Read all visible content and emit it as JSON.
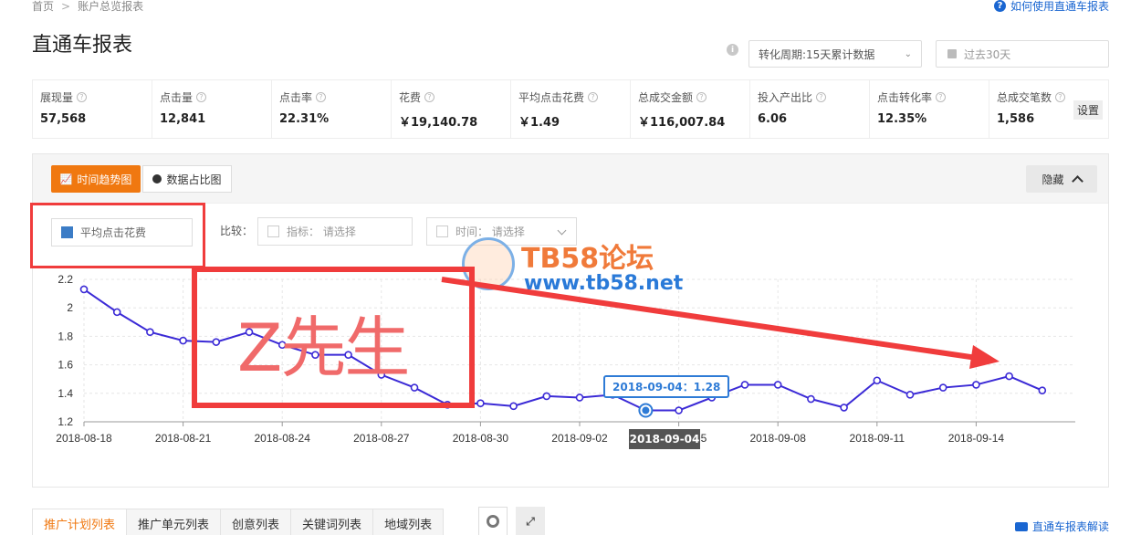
{
  "breadcrumb": {
    "home": "首页",
    "current": "账户总览报表"
  },
  "help_link": "如何使用直通车报表",
  "page_title": "直通车报表",
  "period_select": "转化周期:15天累计数据",
  "date_range": "过去30天",
  "metrics": [
    {
      "label": "展现量",
      "value": "57,568"
    },
    {
      "label": "点击量",
      "value": "12,841"
    },
    {
      "label": "点击率",
      "value": "22.31%"
    },
    {
      "label": "花费",
      "value": "￥19,140.78"
    },
    {
      "label": "平均点击花费",
      "value": "￥1.49"
    },
    {
      "label": "总成交金额",
      "value": "￥116,007.84"
    },
    {
      "label": "投入产出比",
      "value": "6.06"
    },
    {
      "label": "点击转化率",
      "value": "12.35%"
    },
    {
      "label": "总成交笔数",
      "value": "1,586"
    }
  ],
  "settings_button": "设置",
  "chart_tabs": {
    "trend": "时间趋势图",
    "pie": "数据占比图"
  },
  "hide_button": "隐藏",
  "legend": "平均点击花费",
  "compare": {
    "label": "比较：",
    "metric_placeholder": "指标： 请选择",
    "time_placeholder": "时间： 请选择"
  },
  "annotation_text": "Z先生",
  "watermark": {
    "title": "TB58论坛",
    "url": "www.tb58.net"
  },
  "tooltip": "2018-09-04：1.28",
  "highlight_x": "2018-09-04",
  "chart_data": {
    "type": "line",
    "x": [
      "2018-08-18",
      "2018-08-19",
      "2018-08-20",
      "2018-08-21",
      "2018-08-22",
      "2018-08-23",
      "2018-08-24",
      "2018-08-25",
      "2018-08-26",
      "2018-08-27",
      "2018-08-28",
      "2018-08-29",
      "2018-08-30",
      "2018-08-31",
      "2018-09-01",
      "2018-09-02",
      "2018-09-03",
      "2018-09-04",
      "2018-09-05",
      "2018-09-06",
      "2018-09-07",
      "2018-09-08",
      "2018-09-09",
      "2018-09-10",
      "2018-09-11",
      "2018-09-12",
      "2018-09-13",
      "2018-09-14",
      "2018-09-15",
      "2018-09-16",
      "2018-09-17"
    ],
    "series": [
      {
        "name": "平均点击花费",
        "values": [
          2.13,
          1.97,
          1.83,
          1.77,
          1.76,
          1.83,
          1.74,
          1.67,
          1.67,
          1.53,
          1.44,
          1.32,
          1.33,
          1.31,
          1.38,
          1.37,
          1.39,
          1.28,
          1.28,
          1.37,
          1.46,
          1.46,
          1.36,
          1.3,
          1.49,
          1.39,
          1.44,
          1.46,
          1.52,
          1.42,
          null
        ]
      }
    ],
    "x_tick_labels": [
      "2018-08-18",
      "2018-08-21",
      "2018-08-24",
      "2018-08-27",
      "2018-08-30",
      "2018-09-02",
      "2018-09-05",
      "2018-09-08",
      "2018-09-11",
      "2018-09-14"
    ],
    "y_ticks": [
      "2.2",
      "2",
      "1.8",
      "1.6",
      "1.4",
      "1.2"
    ],
    "ylim": [
      1.2,
      2.2
    ],
    "line_color": "#3b2ad6",
    "highlight_color": "#2e7bd6",
    "grid": true
  },
  "bottom_tabs": [
    "推广计划列表",
    "推广单元列表",
    "创意列表",
    "关键词列表",
    "地域列表"
  ],
  "explain_link": "直通车报表解读"
}
